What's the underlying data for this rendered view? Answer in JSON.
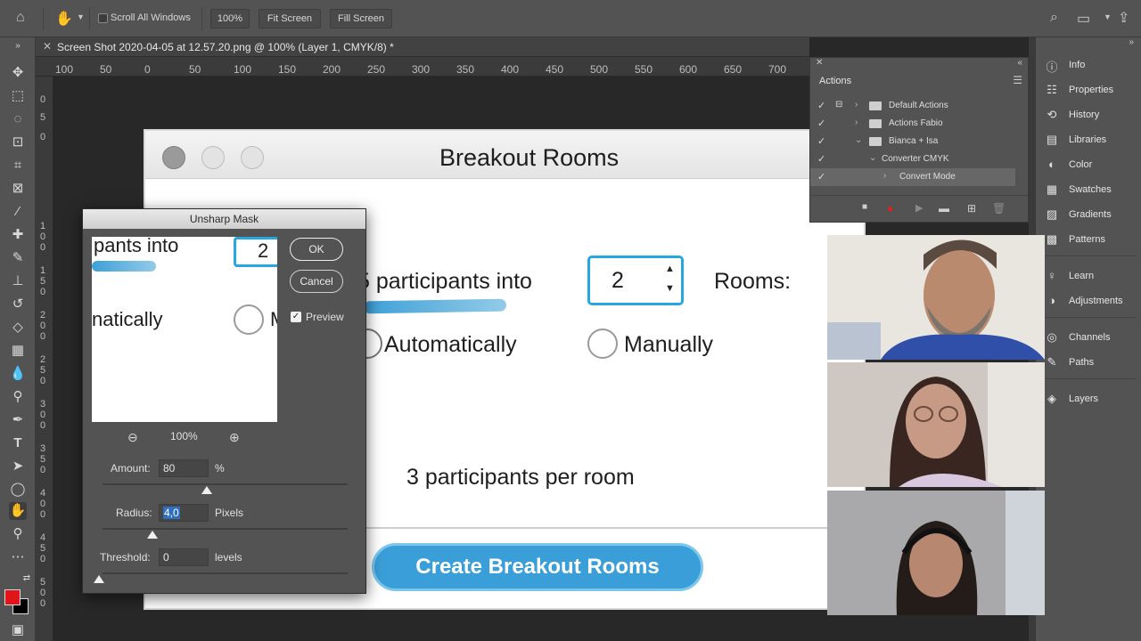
{
  "options_bar": {
    "scroll_all_windows": "Scroll All Windows",
    "zoom": "100%",
    "fit_screen": "Fit Screen",
    "fill_screen": "Fill Screen"
  },
  "document": {
    "tab_title": "Screen Shot 2020-04-05 at 12.57.20.png @ 100% (Layer 1, CMYK/8) *",
    "ruler_top": [
      "100",
      "50",
      "0",
      "50",
      "100",
      "150",
      "200",
      "250",
      "300",
      "350",
      "400",
      "450",
      "500",
      "550",
      "600",
      "650",
      "700"
    ],
    "ruler_left": [
      "0",
      "5",
      "0",
      "1 0 0",
      "1 5 0",
      "2 0 0",
      "2 5 0",
      "3 0 0",
      "3 5 0",
      "4 0 0",
      "4 5 0",
      "5 0 0"
    ]
  },
  "breakout": {
    "title": "Breakout Rooms",
    "assign_text": "5 participants into",
    "rooms_value": "2",
    "rooms_label": "Rooms:",
    "automatically": "Automatically",
    "manually": "Manually",
    "per_room": "3 participants per room",
    "create_button": "Create Breakout Rooms"
  },
  "unsharp": {
    "title": "Unsharp Mask",
    "ok": "OK",
    "cancel": "Cancel",
    "preview_label": "Preview",
    "preview_checked": true,
    "zoom": "100%",
    "preview_text_1": "pants into",
    "preview_value": "2",
    "preview_text_2": "natically",
    "preview_text_3": "M",
    "amount_label": "Amount:",
    "amount_value": "80",
    "amount_unit": "%",
    "radius_label": "Radius:",
    "radius_value": "4,0",
    "radius_unit": "Pixels",
    "threshold_label": "Threshold:",
    "threshold_value": "0",
    "threshold_unit": "levels"
  },
  "actions_panel": {
    "tab": "Actions",
    "rows": [
      {
        "name": "Default Actions",
        "level": 0,
        "type": "set"
      },
      {
        "name": "Actions Fabio",
        "level": 0,
        "type": "set"
      },
      {
        "name": "Bianca + Isa",
        "level": 0,
        "type": "set"
      },
      {
        "name": "Converter CMYK",
        "level": 1,
        "type": "action"
      },
      {
        "name": "Convert Mode",
        "level": 2,
        "type": "step"
      }
    ]
  },
  "dock": {
    "items": [
      {
        "label": "Info",
        "icon": "info-icon"
      },
      {
        "label": "Properties",
        "icon": "properties-icon"
      },
      {
        "label": "History",
        "icon": "history-icon"
      },
      {
        "label": "Libraries",
        "icon": "libraries-icon"
      },
      {
        "label": "Color",
        "icon": "color-icon"
      },
      {
        "label": "Swatches",
        "icon": "swatches-icon"
      },
      {
        "label": "Gradients",
        "icon": "gradients-icon"
      },
      {
        "label": "Patterns",
        "icon": "patterns-icon"
      },
      {
        "label": "Learn",
        "icon": "learn-icon"
      },
      {
        "label": "Adjustments",
        "icon": "adjustments-icon"
      },
      {
        "label": "Channels",
        "icon": "channels-icon"
      },
      {
        "label": "Paths",
        "icon": "paths-icon"
      },
      {
        "label": "Layers",
        "icon": "layers-icon"
      }
    ]
  },
  "colors": {
    "foreground": "#e0141a",
    "background": "#000000",
    "zoom_accent": "#27a7e0",
    "record": "#e02020"
  }
}
